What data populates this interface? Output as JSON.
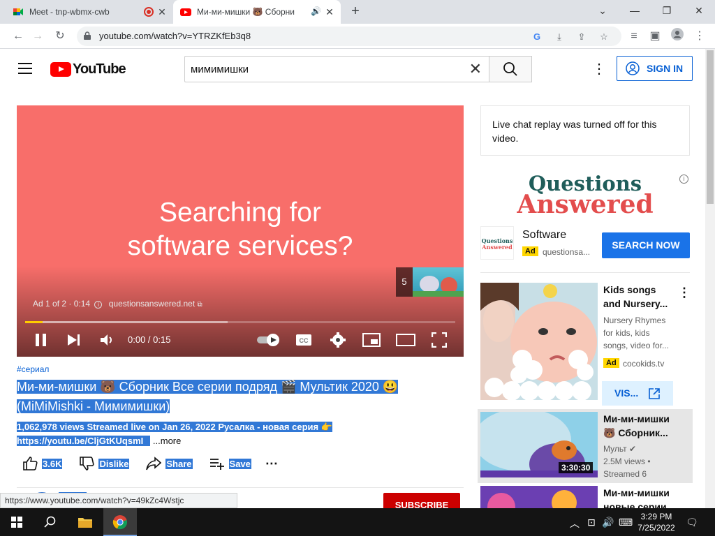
{
  "browser": {
    "tabs": [
      {
        "title": "Meet - tnp-wbmx-cwb"
      },
      {
        "title": "Ми-ми-мишки 🐻 Сборни"
      }
    ],
    "url": "youtube.com/watch?v=YTRZKfEb3q8",
    "status_url": "https://www.youtube.com/watch?v=49kZc4Wstjc"
  },
  "header": {
    "logo_text": "YouTube",
    "search_value": "мимимишки",
    "signin_label": "SIGN IN"
  },
  "player": {
    "ad_line1": "Searching for",
    "ad_line2": "software services?",
    "ad_info": "Ad 1 of 2 · 0:14",
    "ad_domain": "questionsanswered.net",
    "next_count": "5",
    "time": "0:00 / 0:15",
    "progress_played": 0.04,
    "progress_buffered": 0.47,
    "accent": "#ffcc00",
    "ad_bg": "#f86e6a"
  },
  "video": {
    "hashtag": "#сериал",
    "title": "Ми-ми-мишки 🐻 Сборник Все серии подряд 🎬 Мультик 2020 😃 (MiMiMishki - Мимимишки)",
    "desc_line1": "1,062,978 views  Streamed live on Jan 26, 2022  Русалка - новая серия 👉",
    "desc_line2": "https://youtu.be/CljGtKUqsmI",
    "more": "...more",
    "likes": "3.6K",
    "dislike": "Dislike",
    "share": "Share",
    "save": "Save",
    "subscribe": "SUBSCRIBE"
  },
  "sidebar": {
    "live_chat": "Live chat replay was turned off for this video.",
    "ad_logo_l1": "Questions",
    "ad_logo_l2": "Answered",
    "ad_card": {
      "logo_text": "Questions Answered",
      "name": "Software",
      "badge": "Ad",
      "domain": "questionsa...",
      "cta": "SEARCH NOW"
    },
    "recs": [
      {
        "title": "Kids songs and Nursery...",
        "sub": "Nursery Rhymes for kids, kids songs, video for...",
        "badge": "Ad",
        "domain": "cocokids.tv",
        "cta": "VIS..."
      },
      {
        "title": "Ми-ми-мишки 🐻 Сборник...",
        "channel": "Мульт ✔",
        "views": "2.5M views •",
        "streamed": "Streamed 6",
        "duration": "3:30:30"
      },
      {
        "title": "Ми-ми-мишки новые серии"
      }
    ]
  },
  "taskbar": {
    "time": "3:29 PM",
    "date": "7/25/2022"
  }
}
